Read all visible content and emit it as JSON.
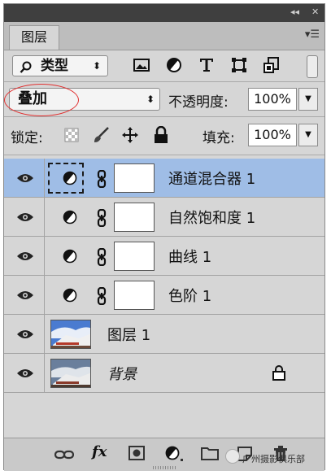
{
  "panel": {
    "tab_label": "图层",
    "menu_icon": "panel-menu-icon",
    "collapse_icon": "double-chevron-icon",
    "close_icon": "close-icon"
  },
  "filter": {
    "kind_label": "类型",
    "icons": [
      "image-filter-icon",
      "adjustment-filter-icon",
      "type-filter-icon",
      "shape-filter-icon",
      "smart-object-filter-icon"
    ]
  },
  "blend": {
    "mode": "叠加",
    "opacity_label": "不透明度:",
    "opacity_value": "100%"
  },
  "lock": {
    "label": "锁定:",
    "fill_label": "填充:",
    "fill_value": "100%",
    "icons": [
      "lock-transparent-icon",
      "lock-paint-icon",
      "lock-move-icon",
      "lock-all-icon"
    ]
  },
  "layers": [
    {
      "name": "通道混合器 1",
      "type": "adjustment",
      "selected": true
    },
    {
      "name": "自然饱和度 1",
      "type": "adjustment",
      "selected": false
    },
    {
      "name": "曲线 1",
      "type": "adjustment",
      "selected": false
    },
    {
      "name": "色阶 1",
      "type": "adjustment",
      "selected": false
    },
    {
      "name": "图层 1",
      "type": "image",
      "selected": false
    },
    {
      "name": "背景",
      "type": "background",
      "selected": false,
      "locked": true
    }
  ],
  "bottom_icons": [
    "link-layers-icon",
    "fx-icon",
    "add-mask-icon",
    "new-adjustment-icon",
    "new-group-icon",
    "new-layer-icon",
    "delete-icon"
  ],
  "fx_label": "fx",
  "watermark": "广州摄影俱乐部"
}
